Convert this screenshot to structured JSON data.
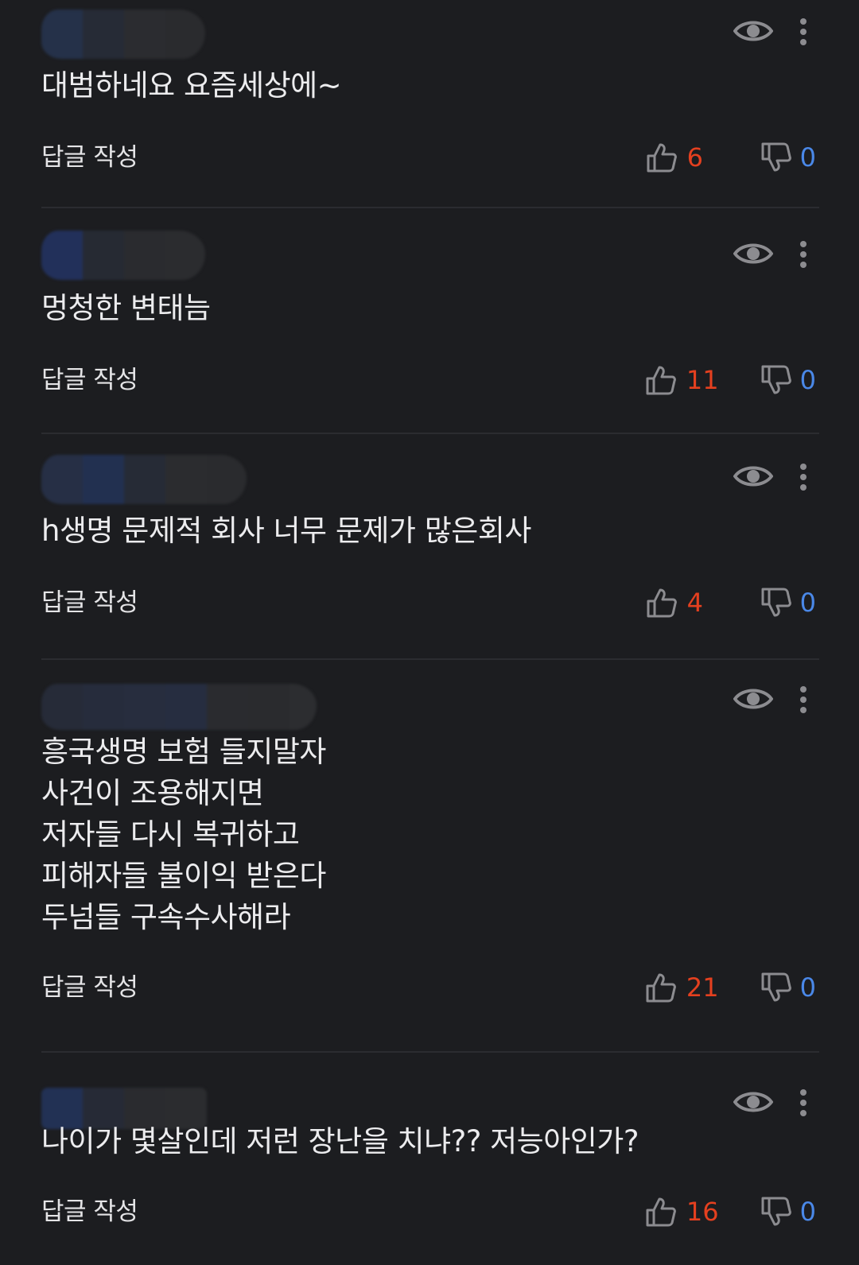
{
  "colors": {
    "background": "#1c1d20",
    "like_count": "#e4401f",
    "dislike_count": "#4a88e8",
    "icon": "#8c8c90",
    "divider": "#2b2c30"
  },
  "icons": {
    "visibility": "eye-icon",
    "more": "more-vertical-icon",
    "like": "thumbs-up-icon",
    "dislike": "thumbs-down-icon"
  },
  "reply_label": "답글 작성",
  "comments": [
    {
      "author_blurred": true,
      "text": "대범하네요  요즘세상에~",
      "likes": "6",
      "dislikes": "0"
    },
    {
      "author_blurred": true,
      "text": "멍청한 변태늠",
      "likes": "11",
      "dislikes": "0"
    },
    {
      "author_blurred": true,
      "text": "h생명 문제적 회사  너무 문제가 많은회사",
      "likes": "4",
      "dislikes": "0"
    },
    {
      "author_blurred": true,
      "text": "흥국생명 보험 들지말자\n사건이 조용해지면\n저자들 다시 복귀하고\n피해자들 불이익 받은다\n두넘들 구속수사해라",
      "likes": "21",
      "dislikes": "0"
    },
    {
      "author_blurred": true,
      "text": "나이가 몇살인데 저런 장난을 치냐?? 저능아인가?",
      "likes": "16",
      "dislikes": "0"
    }
  ]
}
